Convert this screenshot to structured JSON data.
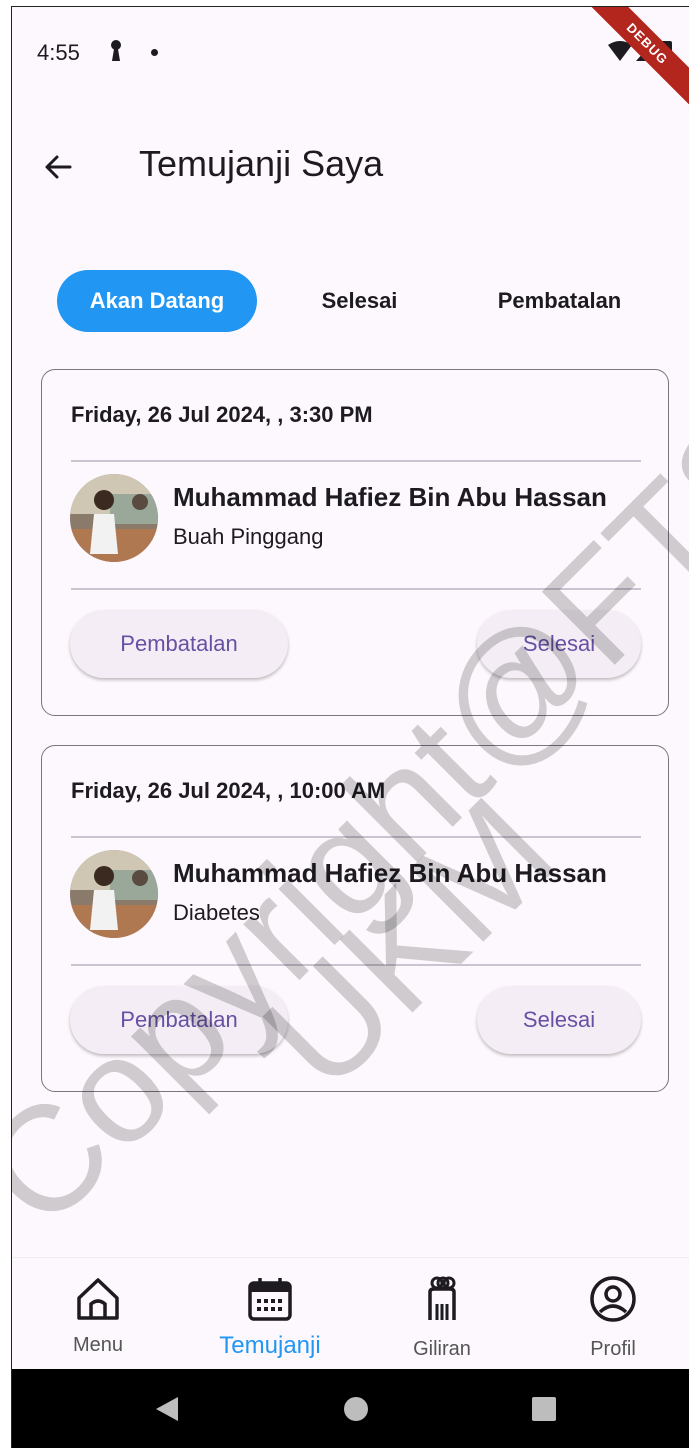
{
  "status_bar": {
    "time": "4:55",
    "debug_banner": "DEBUG"
  },
  "header": {
    "title": "Temujanji Saya"
  },
  "tabs": [
    {
      "label": "Akan Datang",
      "active": true
    },
    {
      "label": "Selesai",
      "active": false
    },
    {
      "label": "Pembatalan",
      "active": false
    }
  ],
  "appointments": [
    {
      "datetime": "Friday, 26 Jul 2024, , 3:30 PM",
      "doctor_name": "Muhammad Hafiez Bin Abu Hassan",
      "specialty": "Buah Pinggang",
      "cancel_label": "Pembatalan",
      "done_label": "Selesai"
    },
    {
      "datetime": "Friday, 26 Jul 2024, , 10:00 AM",
      "doctor_name": "Muhammad Hafiez Bin Abu Hassan",
      "specialty": "Diabetes",
      "cancel_label": "Pembatalan",
      "done_label": "Selesai"
    }
  ],
  "bottom_nav": [
    {
      "label": "Menu",
      "icon": "home-icon",
      "active": false
    },
    {
      "label": "Temujanji",
      "icon": "calendar-icon",
      "active": true
    },
    {
      "label": "Giliran",
      "icon": "queue-icon",
      "active": false
    },
    {
      "label": "Profil",
      "icon": "profile-icon",
      "active": false
    }
  ],
  "watermark": {
    "line1": "Copyright@FTSM",
    "line2": "UKM"
  },
  "colors": {
    "accent": "#2196f3",
    "button_text": "#6750a4",
    "background": "#fdf8fd"
  }
}
